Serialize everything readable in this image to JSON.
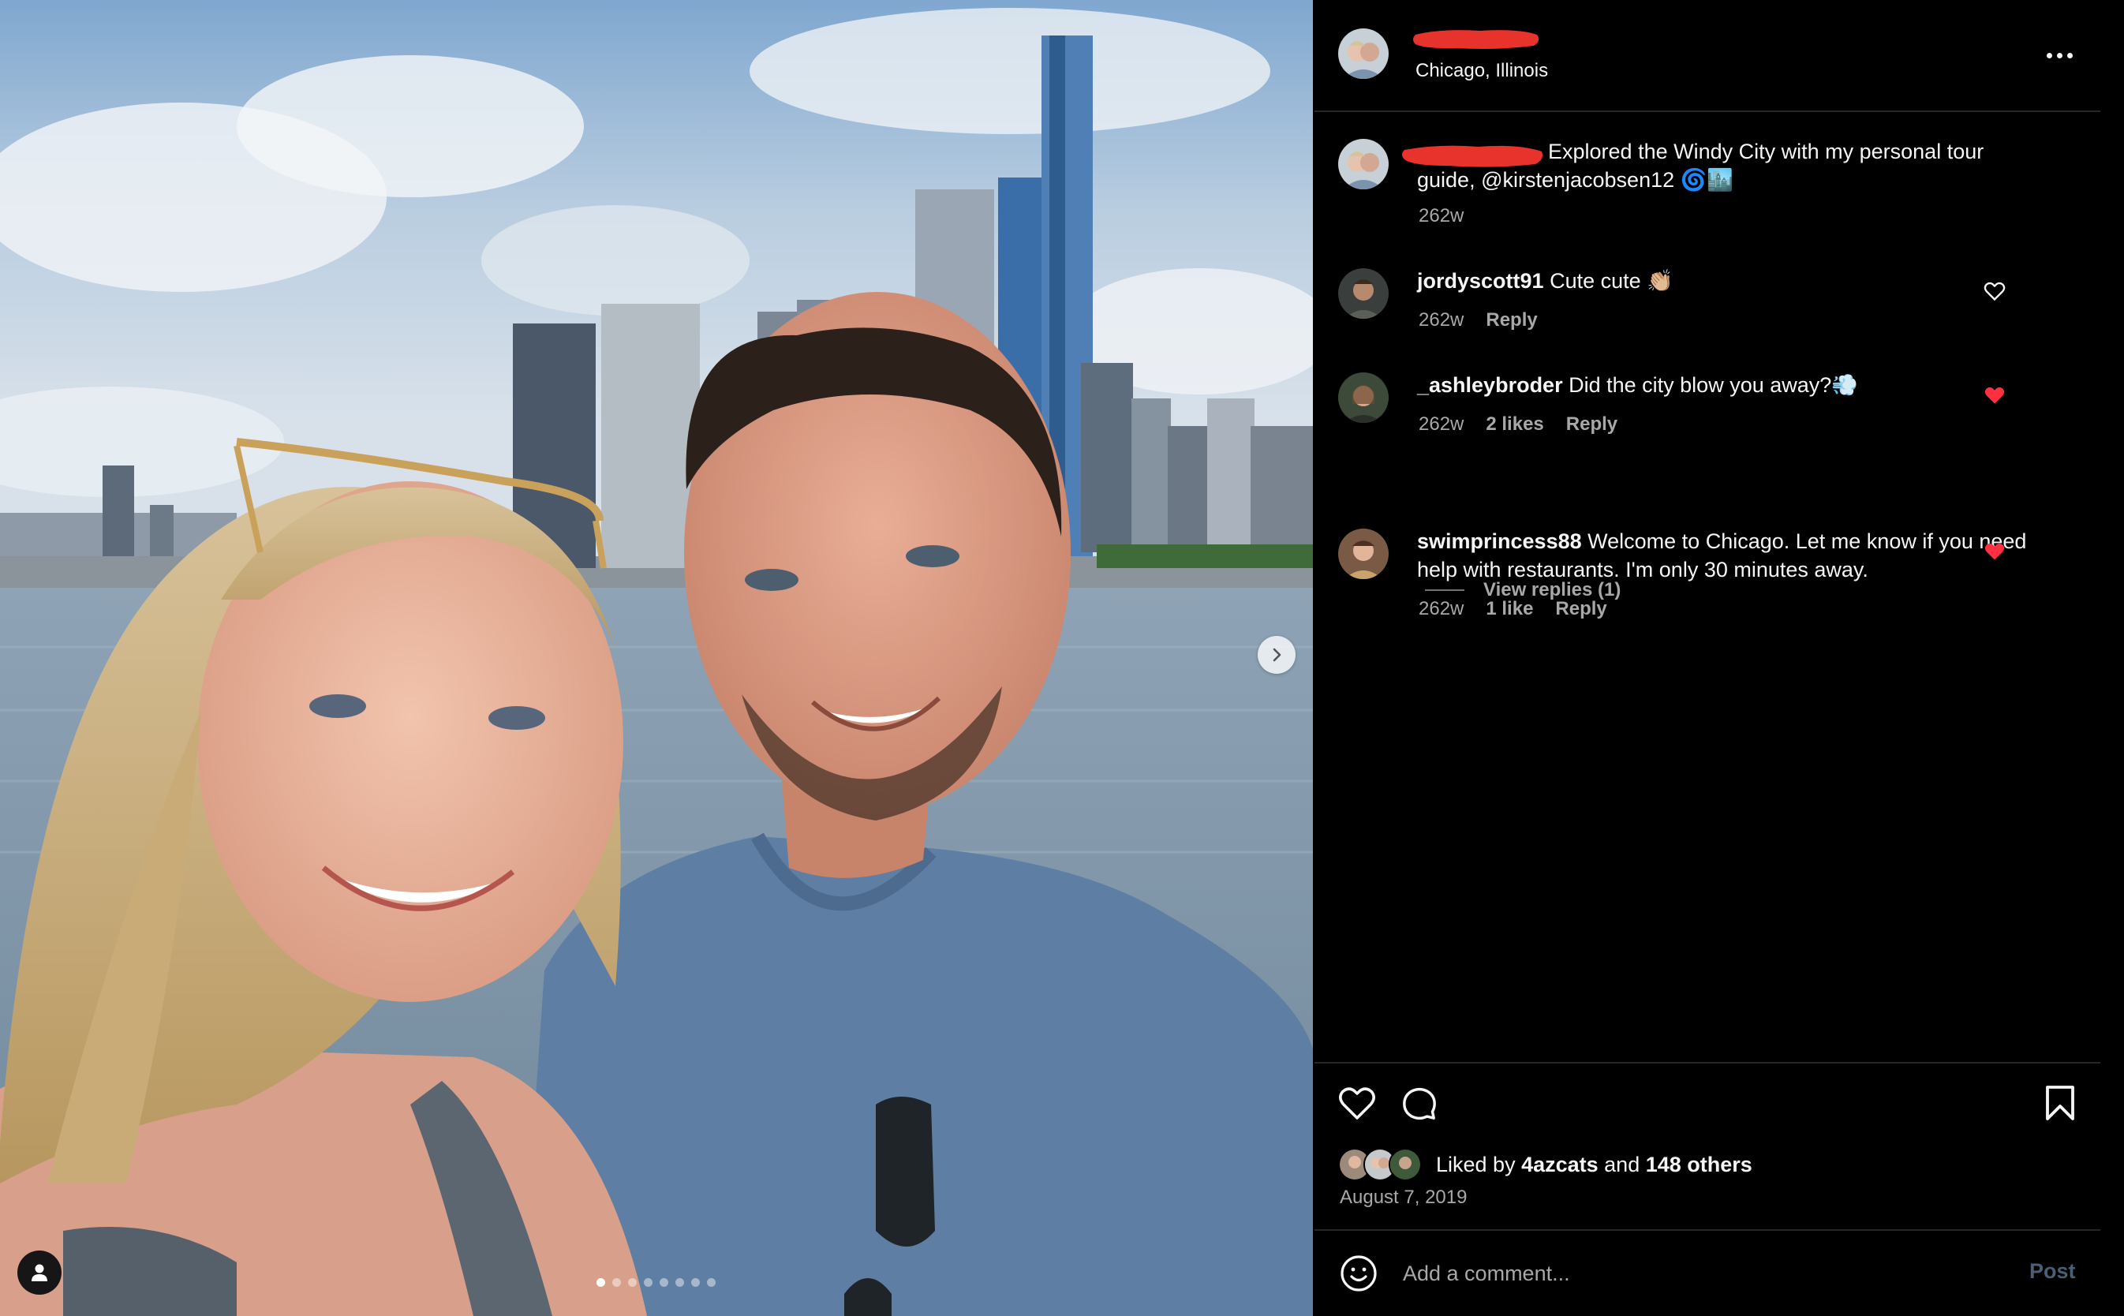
{
  "post": {
    "location": "Chicago, Illinois",
    "more_label": "More options",
    "media": {
      "slide_count": 8,
      "active_slide": 0,
      "next_label": "Next",
      "tag_label": "Tags"
    },
    "caption": {
      "text": "Explored the Windy City with my personal tour guide, ",
      "mention": "@kirstenjacobsen12",
      "emoji": " 🌀🏙️",
      "time": "262w"
    },
    "comments": [
      {
        "user": "jordyscott91",
        "text": "Cute cute 👏🏼",
        "time": "262w",
        "likes": "",
        "reply": "Reply",
        "liked": false
      },
      {
        "user": "_ashleybroder",
        "text": "Did the city blow you away?💨",
        "time": "262w",
        "likes": "2 likes",
        "reply": "Reply",
        "liked": true
      },
      {
        "user": "swimprincess88",
        "text": "Welcome to Chicago. Let me know if you need help with restaurants. I'm only 30 minutes away.",
        "time": "262w",
        "likes": "1 like",
        "reply": "Reply",
        "liked": true
      }
    ],
    "view_replies": "View replies (1)",
    "liked_by": {
      "prefix": "Liked by ",
      "user": "4azcats",
      "middle": " and ",
      "others": "148 others"
    },
    "date": "August 7, 2019",
    "add_comment_placeholder": "Add a comment...",
    "post_button": "Post",
    "colors": {
      "accent_heart": "#ff3040",
      "redaction": "#e8322c",
      "post_button_disabled": "#4a5f73"
    },
    "icons": [
      "heart-icon",
      "comment-icon",
      "bookmark-icon",
      "emoji-icon",
      "chevron-right-icon",
      "user-tag-icon",
      "more-icon"
    ]
  }
}
